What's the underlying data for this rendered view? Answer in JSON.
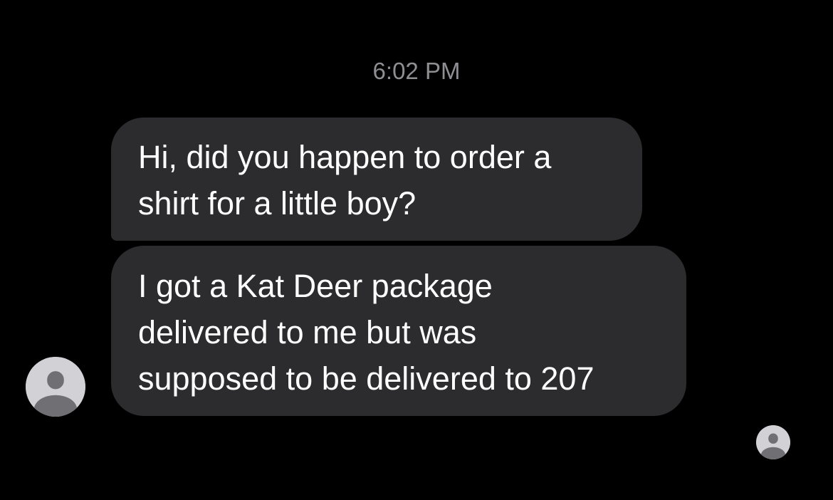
{
  "conversation": {
    "timestamp": "6:02 PM",
    "messages": [
      {
        "direction": "incoming",
        "lines": [
          "Hi, did you happen to order a",
          "shirt for a little boy?"
        ]
      },
      {
        "direction": "incoming",
        "lines": [
          "I got a Kat Deer package",
          "delivered to me but was",
          "supposed to be delivered to 207"
        ]
      }
    ]
  },
  "avatars": {
    "sender": {
      "icon": "person-silhouette-icon"
    },
    "read_receipt": {
      "icon": "person-silhouette-icon"
    }
  },
  "colors": {
    "background": "#000000",
    "bubble": "#2c2c2e",
    "message_text": "#ffffff",
    "timestamp_text": "#8e8e93",
    "avatar_bg": "#d1d1d6",
    "avatar_glyph": "#707074"
  }
}
